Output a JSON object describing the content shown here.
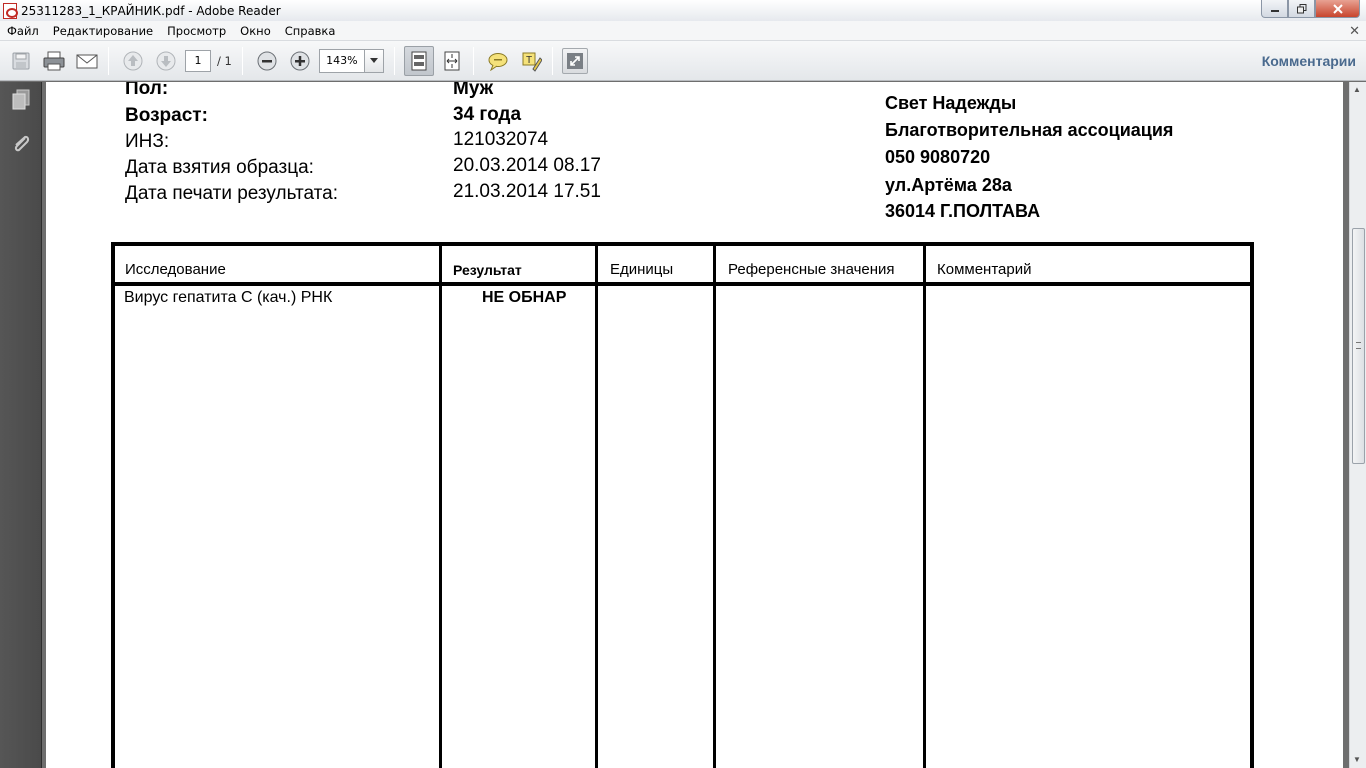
{
  "window": {
    "title": "25311283_1_КРАЙНИК.pdf - Adobe Reader"
  },
  "menu": [
    "Файл",
    "Редактирование",
    "Просмотр",
    "Окно",
    "Справка"
  ],
  "toolbar": {
    "page_current": "1",
    "page_total": "/ 1",
    "zoom": "143%",
    "comments_label": "Комментарии"
  },
  "document": {
    "patient": {
      "gender_label": "Пол:",
      "gender_value": "Муж",
      "age_label": "Возраст:",
      "age_value": "34 года",
      "inz_label": "ИНЗ:",
      "inz_value": "121032074",
      "sample_date_label": "Дата взятия образца:",
      "sample_date_value": "20.03.2014 08.17",
      "print_date_label": "Дата печати результата:",
      "print_date_value": "21.03.2014 17.51"
    },
    "organization": {
      "line1": "Свет Надежды",
      "line2": "Благотворительная ассоциация",
      "line3": "050 9080720",
      "line4": "ул.Артёма 28а",
      "line5": "36014 Г.ПОЛТАВА"
    },
    "table": {
      "headers": {
        "test": "Исследование",
        "result": "Результат",
        "units": "Единицы",
        "reference": "Референсные значения",
        "comment": "Комментарий"
      },
      "rows": [
        {
          "test": "Вирус гепатита С (кач.) РНК",
          "result": "НЕ ОБНАР",
          "units": "",
          "reference": "",
          "comment": ""
        }
      ]
    }
  },
  "colors": {
    "comments_link": "#4a6a8e",
    "nav_panel": "#4f4f4f",
    "doc_background": "#6e6e6e"
  }
}
